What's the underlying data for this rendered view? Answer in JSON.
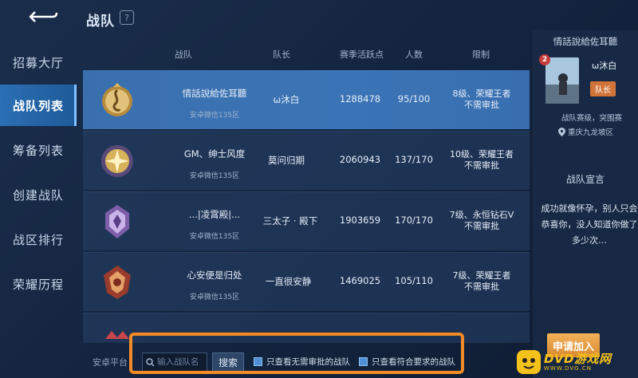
{
  "header": {
    "title": "战队",
    "help_glyph": "?"
  },
  "sidebar": {
    "items": [
      {
        "label": "招募大厅",
        "active": false
      },
      {
        "label": "战队列表",
        "active": true
      },
      {
        "label": "筹备列表",
        "active": false
      },
      {
        "label": "创建战队",
        "active": false
      },
      {
        "label": "战区排行",
        "active": false
      },
      {
        "label": "荣耀历程",
        "active": false
      }
    ]
  },
  "table": {
    "columns": [
      "战队",
      "队长",
      "赛季活跃点",
      "人数",
      "限制"
    ],
    "rows": [
      {
        "name": "情話說給佐耳聽",
        "zone": "安卓微信135区",
        "leader": "ω沐白",
        "points": "1288478",
        "members": "95/100",
        "limit1": "8级、荣耀王者",
        "limit2": "不需审批",
        "selected": true
      },
      {
        "name": "GM、绅士风度",
        "zone": "安卓微信135区",
        "leader": "莫问归期",
        "points": "2060943",
        "members": "137/170",
        "limit1": "10级、荣耀王者",
        "limit2": "不需审批",
        "selected": false
      },
      {
        "name": "...|凌霄殿|...",
        "zone": "安卓微信135区",
        "leader": "三太子 · 殿下",
        "points": "1903659",
        "members": "170/170",
        "limit1": "7级、永恒钻石V",
        "limit2": "不需审批",
        "selected": false
      },
      {
        "name": "心安便是归处",
        "zone": "安卓微信135区",
        "leader": "一直很安静",
        "points": "1469025",
        "members": "105/110",
        "limit1": "7级、荣耀王者",
        "limit2": "不需审批",
        "selected": false
      }
    ]
  },
  "detail": {
    "team_name": "情話說給佐耳聽",
    "level": "2",
    "leader_sig": "ω沐白",
    "role": "队长",
    "tags": "战队赛级，突围赛",
    "location": "重庆九龙坡区",
    "declaration_title": "战队宣言",
    "declaration": "成功就像怀孕，别人只会恭喜你，没人知道你做了多少次…",
    "apply_label": "申请加入"
  },
  "bottom": {
    "platform_label": "安卓平台",
    "search_placeholder": "输入战队名",
    "search_button": "搜索",
    "filter1": "只查看无需审批的战队",
    "filter2": "只查看符合要求的战队"
  },
  "watermark": {
    "text": "DVD游戏网",
    "sub": "WWW.DVG.CN"
  },
  "colors": {
    "accent": "#3b74b6",
    "highlight": "#f28a26",
    "apply": "#d88a2f"
  }
}
